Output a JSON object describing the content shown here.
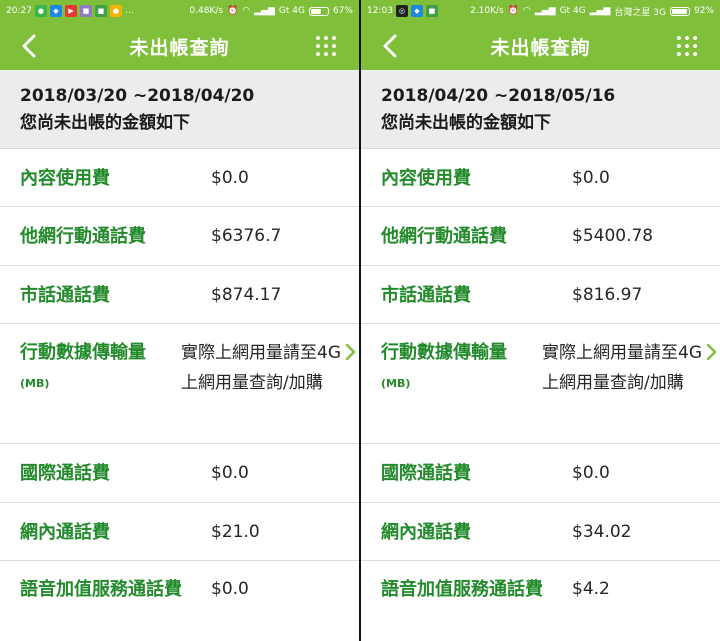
{
  "screens": [
    {
      "status": {
        "time": "20:27",
        "speed": "0.48K/s",
        "network": "Gt 4G",
        "carrier": "",
        "battery": "67%",
        "battery_level": 0.67
      },
      "header": {
        "title": "未出帳查詢"
      },
      "period": {
        "dates": "2018/03/20 ~2018/04/20",
        "subtitle": "您尚未出帳的金額如下"
      },
      "rows": [
        {
          "label": "內容使用費",
          "value": "$0.0"
        },
        {
          "label": "他網行動通話費",
          "value": "$6376.7"
        },
        {
          "label": "市話通話費",
          "value": "$874.17"
        },
        {
          "label": "行動數據傳輸量",
          "unit": "(MB)",
          "value": "實際上網用量請至4G上網用量查詢/加購"
        },
        {
          "label": "國際通話費",
          "value": "$0.0"
        },
        {
          "label": "網內通話費",
          "value": "$21.0"
        },
        {
          "label": "語音加值服務通話費",
          "value": "$0.0"
        }
      ]
    },
    {
      "status": {
        "time": "12:03",
        "speed": "2.10K/s",
        "network": "Gt 4G",
        "carrier": "台灣之星 3G",
        "battery": "92%",
        "battery_level": 0.92
      },
      "header": {
        "title": "未出帳查詢"
      },
      "period": {
        "dates": "2018/04/20 ~2018/05/16",
        "subtitle": "您尚未出帳的金額如下"
      },
      "rows": [
        {
          "label": "內容使用費",
          "value": "$0.0"
        },
        {
          "label": "他網行動通話費",
          "value": "$5400.78"
        },
        {
          "label": "市話通話費",
          "value": "$816.97"
        },
        {
          "label": "行動數據傳輸量",
          "unit": "(MB)",
          "value": "實際上網用量請至4G上網用量查詢/加購"
        },
        {
          "label": "國際通話費",
          "value": "$0.0"
        },
        {
          "label": "網內通話費",
          "value": "$34.02"
        },
        {
          "label": "語音加值服務通話費",
          "value": "$4.2"
        }
      ]
    }
  ],
  "colors": {
    "appbar": "#7fbf3a",
    "label_green": "#238b2c",
    "period_bg": "#ececec"
  },
  "icons": {
    "back": "chevron-left-icon",
    "menu": "grid-menu-icon",
    "row_arrow": "chevron-right-icon"
  }
}
